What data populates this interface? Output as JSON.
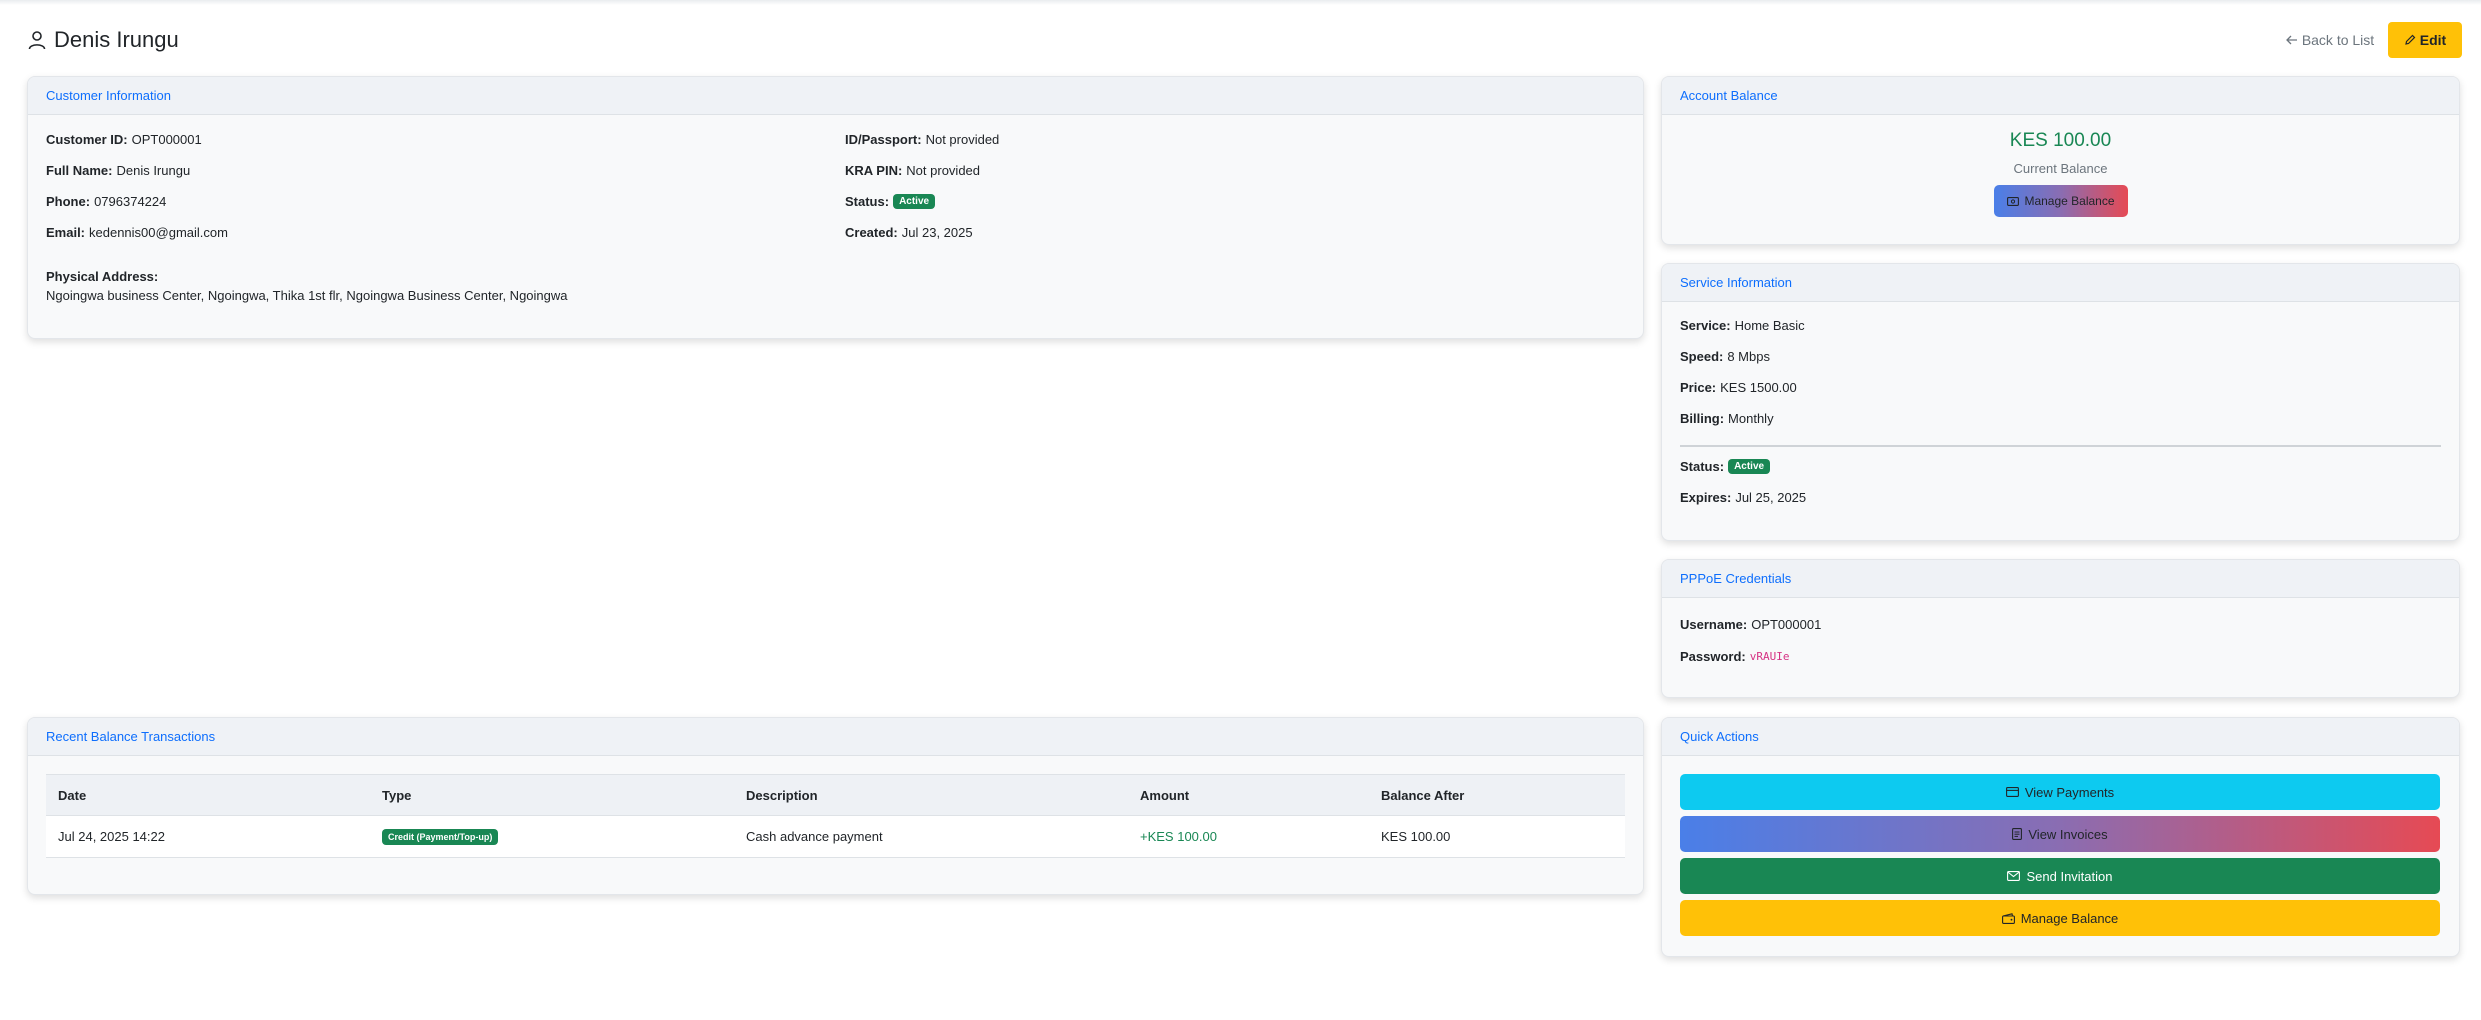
{
  "header": {
    "title": "Denis Irungu",
    "back_label": "Back to List",
    "edit_label": "Edit"
  },
  "customer_info": {
    "heading": "Customer Information",
    "left": [
      {
        "label": "Customer ID:",
        "value": "OPT000001"
      },
      {
        "label": "Full Name:",
        "value": "Denis Irungu"
      },
      {
        "label": "Phone:",
        "value": "0796374224"
      },
      {
        "label": "Email:",
        "value": "kedennis00@gmail.com"
      }
    ],
    "right": {
      "id_label": "ID/Passport:",
      "id_value": "Not provided",
      "kra_label": "KRA PIN:",
      "kra_value": "Not provided",
      "status_label": "Status:",
      "status_value": "Active",
      "created_label": "Created:",
      "created_value": "Jul 23, 2025"
    },
    "address_label": "Physical Address:",
    "address_value": "Ngoingwa business Center, Ngoingwa, Thika 1st flr, Ngoingwa Business Center, Ngoingwa"
  },
  "account_balance": {
    "heading": "Account Balance",
    "amount": "KES 100.00",
    "label": "Current Balance",
    "manage_label": "Manage Balance"
  },
  "service_info": {
    "heading": "Service Information",
    "fields": [
      {
        "label": "Service:",
        "value": "Home Basic"
      },
      {
        "label": "Speed:",
        "value": "8 Mbps"
      },
      {
        "label": "Price:",
        "value": "KES 1500.00"
      },
      {
        "label": "Billing:",
        "value": "Monthly"
      }
    ],
    "status_label": "Status:",
    "status_value": "Active",
    "expires_label": "Expires:",
    "expires_value": "Jul 25, 2025"
  },
  "pppoe": {
    "heading": "PPPoE Credentials",
    "username_label": "Username:",
    "username_value": "OPT000001",
    "password_label": "Password:",
    "password_value": "vRAUIe"
  },
  "transactions": {
    "heading": "Recent Balance Transactions",
    "columns": [
      "Date",
      "Type",
      "Description",
      "Amount",
      "Balance After"
    ],
    "rows": [
      {
        "date": "Jul 24, 2025 14:22",
        "type": "Credit (Payment/Top-up)",
        "description": "Cash advance payment",
        "amount": "+KES 100.00",
        "balance_after": "KES 100.00"
      }
    ]
  },
  "quick_actions": {
    "heading": "Quick Actions",
    "view_payments": "View Payments",
    "view_invoices": "View Invoices",
    "send_invitation": "Send Invitation",
    "manage_balance": "Manage Balance"
  },
  "colors": {
    "primary": "#0d6efd",
    "success": "#198754",
    "warning": "#ffc107",
    "info": "#0dcaf0",
    "danger_pink": "#d63384"
  },
  "icons": [
    "person-icon",
    "arrow-left-icon",
    "pencil-icon",
    "cash-icon",
    "credit-card-icon",
    "file-text-icon",
    "envelope-icon",
    "wallet-icon"
  ]
}
